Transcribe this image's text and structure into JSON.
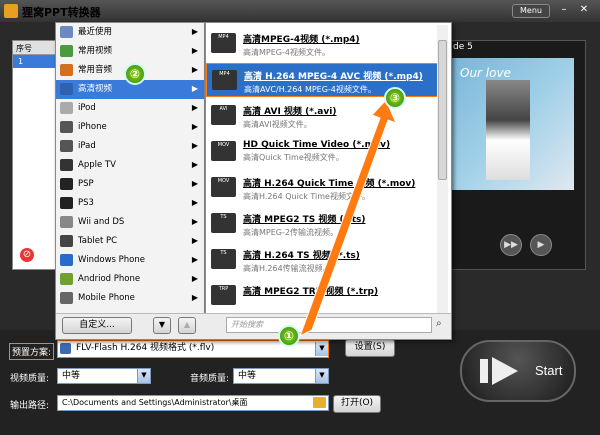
{
  "app": {
    "title": "狸窝PPT转换器",
    "menu_label": "Menu",
    "minimize": "–",
    "close": "✕"
  },
  "filelist": {
    "col_index": "序号",
    "col_name": "1"
  },
  "preview": {
    "label": "de 5",
    "image_text": "Our love"
  },
  "player": {
    "play": "▶▶",
    "fullscreen": "▶"
  },
  "remove_label": "移",
  "categories": [
    {
      "label": "最近使用",
      "icon": "clock-icon",
      "color": "#6b8ac0"
    },
    {
      "label": "常用视频",
      "icon": "video-icon",
      "color": "#4a9a40"
    },
    {
      "label": "常用音频",
      "icon": "audio-icon",
      "color": "#d07020"
    },
    {
      "label": "高清视频",
      "icon": "hd-video-icon",
      "color": "#3060b0"
    },
    {
      "label": "iPod",
      "icon": "ipod-icon",
      "color": "#aaaaaa"
    },
    {
      "label": "iPhone",
      "icon": "iphone-icon",
      "color": "#555555"
    },
    {
      "label": "iPad",
      "icon": "ipad-icon",
      "color": "#555555"
    },
    {
      "label": "Apple TV",
      "icon": "apple-tv-icon",
      "color": "#333333"
    },
    {
      "label": "PSP",
      "icon": "psp-icon",
      "color": "#222222"
    },
    {
      "label": "PS3",
      "icon": "ps3-icon",
      "color": "#222222"
    },
    {
      "label": "Wii and DS",
      "icon": "wii-icon",
      "color": "#888888"
    },
    {
      "label": "Tablet PC",
      "icon": "tablet-icon",
      "color": "#444444"
    },
    {
      "label": "Windows Phone",
      "icon": "windows-phone-icon",
      "color": "#2a6ac8"
    },
    {
      "label": "Andriod Phone",
      "icon": "android-icon",
      "color": "#70a030"
    },
    {
      "label": "Mobile Phone",
      "icon": "mobile-icon",
      "color": "#666666"
    }
  ],
  "formats": [
    {
      "title": "高清MPEG-4视频 (*.mp4)",
      "desc": "高清MPEG-4视频文件。",
      "icon": "MP4"
    },
    {
      "title": "高清 H.264 MPEG-4 AVC 视频 (*.mp4)",
      "desc": "高清AVC/H.264 MPEG-4视频文件。",
      "icon": "MP4"
    },
    {
      "title": "高清 AVI 视频 (*.avi)",
      "desc": "高清AVI视频文件。",
      "icon": "AVI"
    },
    {
      "title": "HD Quick Time Video (*.mov)",
      "desc": "高清Quick Time视频文件。",
      "icon": "MOV"
    },
    {
      "title": "高清 H.264 Quick Time 视频 (*.mov)",
      "desc": "高清H.264 Quick Time视频文件。",
      "icon": "MOV"
    },
    {
      "title": "高清 MPEG2 TS 视频 (*.ts)",
      "desc": "高清MPEG-2传输流视频。",
      "icon": "TS"
    },
    {
      "title": "高清 H.264 TS 视频 (*.ts)",
      "desc": "高清H.264传输流视频。",
      "icon": "TS"
    },
    {
      "title": "高清 MPEG2 TRP 视频 (*.trp)",
      "desc": "",
      "icon": "TRP"
    }
  ],
  "menu_footer": {
    "custom_label": "自定义...",
    "search_placeholder": "开始搜索"
  },
  "settings": {
    "preset_label": "预置方案:",
    "preset_value": "FLV-Flash H.264 视频格式 (*.flv)",
    "settings_btn": "设置(S)",
    "video_quality_label": "视频质量:",
    "video_quality_value": "中等",
    "audio_quality_label": "音频质量:",
    "audio_quality_value": "中等",
    "output_label": "输出路径:",
    "output_value": "C:\\Documents and Settings\\Administrator\\桌面",
    "open_btn": "打开(O)"
  },
  "start_label": "Start",
  "badges": {
    "one": "①",
    "two": "②",
    "three": "③"
  },
  "colors": {
    "accent": "#3a7ad8",
    "annotation_orange": "#ff7a10",
    "badge_green": "#5ab020"
  }
}
